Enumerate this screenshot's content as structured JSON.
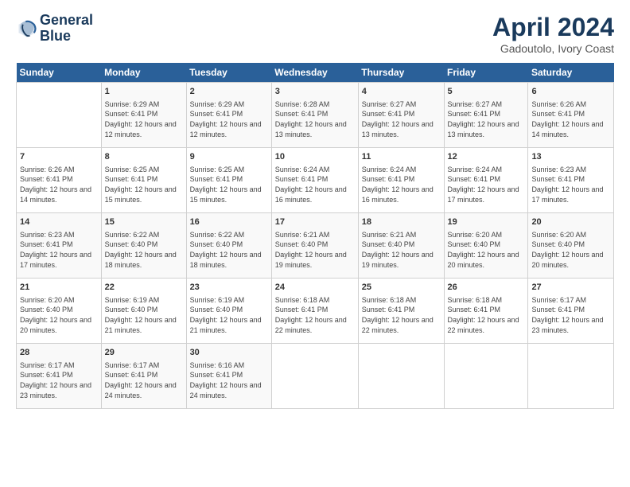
{
  "header": {
    "logo_line1": "General",
    "logo_line2": "Blue",
    "month": "April 2024",
    "location": "Gadoutolo, Ivory Coast"
  },
  "weekdays": [
    "Sunday",
    "Monday",
    "Tuesday",
    "Wednesday",
    "Thursday",
    "Friday",
    "Saturday"
  ],
  "weeks": [
    [
      {
        "day": "",
        "sunrise": "",
        "sunset": "",
        "daylight": "",
        "empty": true
      },
      {
        "day": "1",
        "sunrise": "Sunrise: 6:29 AM",
        "sunset": "Sunset: 6:41 PM",
        "daylight": "Daylight: 12 hours and 12 minutes."
      },
      {
        "day": "2",
        "sunrise": "Sunrise: 6:29 AM",
        "sunset": "Sunset: 6:41 PM",
        "daylight": "Daylight: 12 hours and 12 minutes."
      },
      {
        "day": "3",
        "sunrise": "Sunrise: 6:28 AM",
        "sunset": "Sunset: 6:41 PM",
        "daylight": "Daylight: 12 hours and 13 minutes."
      },
      {
        "day": "4",
        "sunrise": "Sunrise: 6:27 AM",
        "sunset": "Sunset: 6:41 PM",
        "daylight": "Daylight: 12 hours and 13 minutes."
      },
      {
        "day": "5",
        "sunrise": "Sunrise: 6:27 AM",
        "sunset": "Sunset: 6:41 PM",
        "daylight": "Daylight: 12 hours and 13 minutes."
      },
      {
        "day": "6",
        "sunrise": "Sunrise: 6:26 AM",
        "sunset": "Sunset: 6:41 PM",
        "daylight": "Daylight: 12 hours and 14 minutes."
      }
    ],
    [
      {
        "day": "7",
        "sunrise": "Sunrise: 6:26 AM",
        "sunset": "Sunset: 6:41 PM",
        "daylight": "Daylight: 12 hours and 14 minutes."
      },
      {
        "day": "8",
        "sunrise": "Sunrise: 6:25 AM",
        "sunset": "Sunset: 6:41 PM",
        "daylight": "Daylight: 12 hours and 15 minutes."
      },
      {
        "day": "9",
        "sunrise": "Sunrise: 6:25 AM",
        "sunset": "Sunset: 6:41 PM",
        "daylight": "Daylight: 12 hours and 15 minutes."
      },
      {
        "day": "10",
        "sunrise": "Sunrise: 6:24 AM",
        "sunset": "Sunset: 6:41 PM",
        "daylight": "Daylight: 12 hours and 16 minutes."
      },
      {
        "day": "11",
        "sunrise": "Sunrise: 6:24 AM",
        "sunset": "Sunset: 6:41 PM",
        "daylight": "Daylight: 12 hours and 16 minutes."
      },
      {
        "day": "12",
        "sunrise": "Sunrise: 6:24 AM",
        "sunset": "Sunset: 6:41 PM",
        "daylight": "Daylight: 12 hours and 17 minutes."
      },
      {
        "day": "13",
        "sunrise": "Sunrise: 6:23 AM",
        "sunset": "Sunset: 6:41 PM",
        "daylight": "Daylight: 12 hours and 17 minutes."
      }
    ],
    [
      {
        "day": "14",
        "sunrise": "Sunrise: 6:23 AM",
        "sunset": "Sunset: 6:41 PM",
        "daylight": "Daylight: 12 hours and 17 minutes."
      },
      {
        "day": "15",
        "sunrise": "Sunrise: 6:22 AM",
        "sunset": "Sunset: 6:40 PM",
        "daylight": "Daylight: 12 hours and 18 minutes."
      },
      {
        "day": "16",
        "sunrise": "Sunrise: 6:22 AM",
        "sunset": "Sunset: 6:40 PM",
        "daylight": "Daylight: 12 hours and 18 minutes."
      },
      {
        "day": "17",
        "sunrise": "Sunrise: 6:21 AM",
        "sunset": "Sunset: 6:40 PM",
        "daylight": "Daylight: 12 hours and 19 minutes."
      },
      {
        "day": "18",
        "sunrise": "Sunrise: 6:21 AM",
        "sunset": "Sunset: 6:40 PM",
        "daylight": "Daylight: 12 hours and 19 minutes."
      },
      {
        "day": "19",
        "sunrise": "Sunrise: 6:20 AM",
        "sunset": "Sunset: 6:40 PM",
        "daylight": "Daylight: 12 hours and 20 minutes."
      },
      {
        "day": "20",
        "sunrise": "Sunrise: 6:20 AM",
        "sunset": "Sunset: 6:40 PM",
        "daylight": "Daylight: 12 hours and 20 minutes."
      }
    ],
    [
      {
        "day": "21",
        "sunrise": "Sunrise: 6:20 AM",
        "sunset": "Sunset: 6:40 PM",
        "daylight": "Daylight: 12 hours and 20 minutes."
      },
      {
        "day": "22",
        "sunrise": "Sunrise: 6:19 AM",
        "sunset": "Sunset: 6:40 PM",
        "daylight": "Daylight: 12 hours and 21 minutes."
      },
      {
        "day": "23",
        "sunrise": "Sunrise: 6:19 AM",
        "sunset": "Sunset: 6:40 PM",
        "daylight": "Daylight: 12 hours and 21 minutes."
      },
      {
        "day": "24",
        "sunrise": "Sunrise: 6:18 AM",
        "sunset": "Sunset: 6:41 PM",
        "daylight": "Daylight: 12 hours and 22 minutes."
      },
      {
        "day": "25",
        "sunrise": "Sunrise: 6:18 AM",
        "sunset": "Sunset: 6:41 PM",
        "daylight": "Daylight: 12 hours and 22 minutes."
      },
      {
        "day": "26",
        "sunrise": "Sunrise: 6:18 AM",
        "sunset": "Sunset: 6:41 PM",
        "daylight": "Daylight: 12 hours and 22 minutes."
      },
      {
        "day": "27",
        "sunrise": "Sunrise: 6:17 AM",
        "sunset": "Sunset: 6:41 PM",
        "daylight": "Daylight: 12 hours and 23 minutes."
      }
    ],
    [
      {
        "day": "28",
        "sunrise": "Sunrise: 6:17 AM",
        "sunset": "Sunset: 6:41 PM",
        "daylight": "Daylight: 12 hours and 23 minutes."
      },
      {
        "day": "29",
        "sunrise": "Sunrise: 6:17 AM",
        "sunset": "Sunset: 6:41 PM",
        "daylight": "Daylight: 12 hours and 24 minutes."
      },
      {
        "day": "30",
        "sunrise": "Sunrise: 6:16 AM",
        "sunset": "Sunset: 6:41 PM",
        "daylight": "Daylight: 12 hours and 24 minutes."
      },
      {
        "day": "",
        "sunrise": "",
        "sunset": "",
        "daylight": "",
        "empty": true
      },
      {
        "day": "",
        "sunrise": "",
        "sunset": "",
        "daylight": "",
        "empty": true
      },
      {
        "day": "",
        "sunrise": "",
        "sunset": "",
        "daylight": "",
        "empty": true
      },
      {
        "day": "",
        "sunrise": "",
        "sunset": "",
        "daylight": "",
        "empty": true
      }
    ]
  ]
}
